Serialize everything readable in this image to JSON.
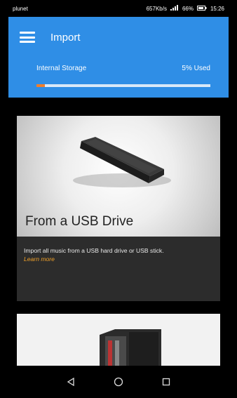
{
  "status_bar": {
    "carrier": "plunet",
    "info": "657Kb/s",
    "battery": "66%",
    "time": "15:26"
  },
  "header": {
    "title": "Import"
  },
  "storage": {
    "label": "Internal Storage",
    "usage_text": "5% Used",
    "used_fraction": 0.05
  },
  "cards": [
    {
      "heading": "From a USB Drive",
      "description": "Import all music from a USB hard drive or USB stick.",
      "link_text": "Learn more"
    }
  ],
  "colors": {
    "appbar": "#2f8ee6",
    "progress_fill": "#f07f2c",
    "link": "#f0a12a"
  },
  "icons": {
    "menu": "hamburger-menu-icon",
    "nav_back": "back-triangle-icon",
    "nav_home": "home-circle-icon",
    "nav_recents": "recents-square-icon"
  }
}
